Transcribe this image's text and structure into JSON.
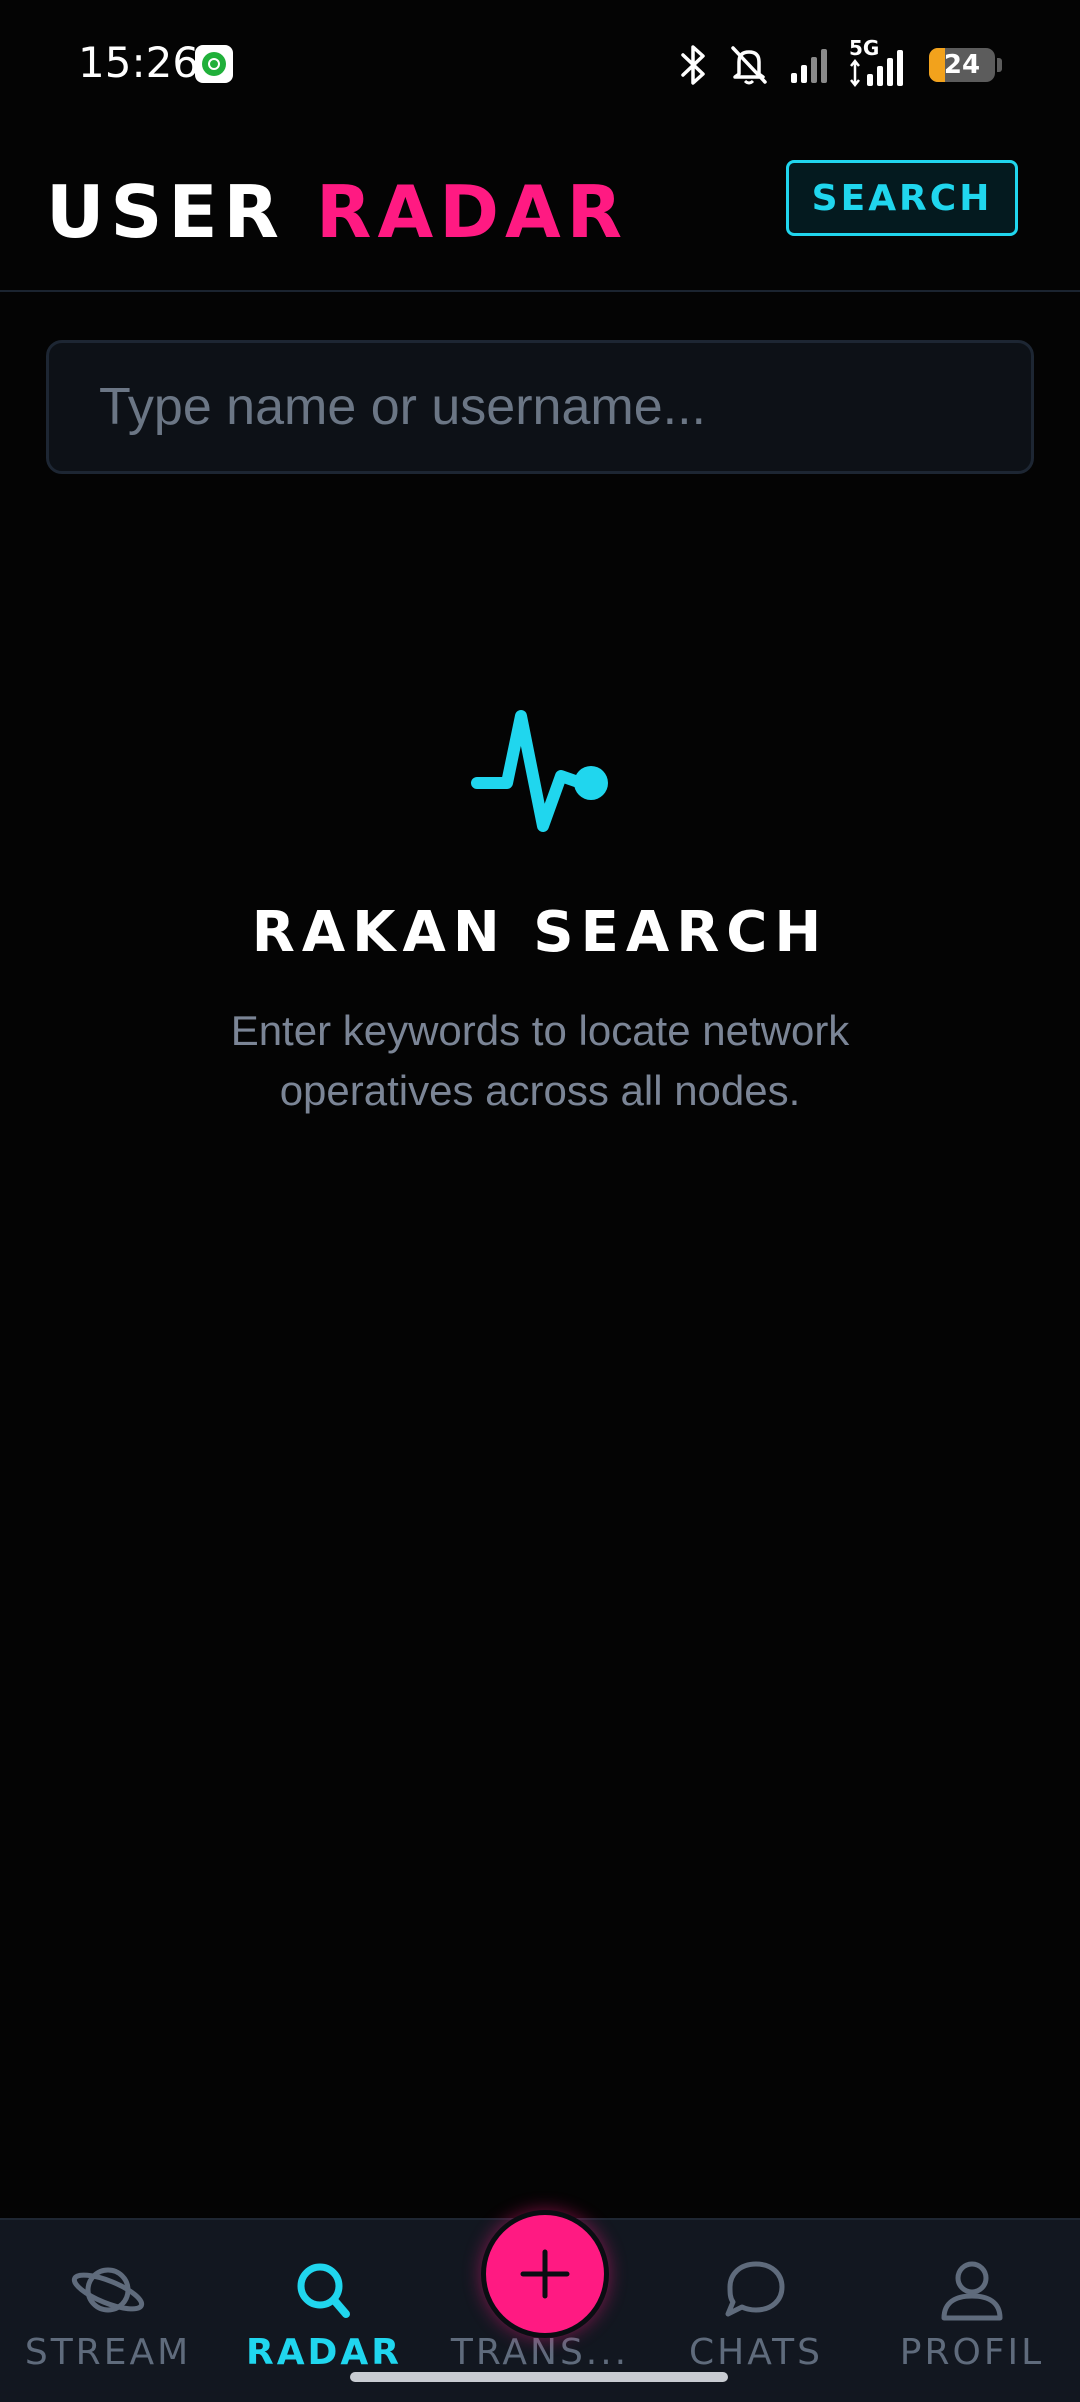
{
  "status_bar": {
    "time": "15:26",
    "network": "5G",
    "battery_level": "24",
    "battery_fraction": 0.24
  },
  "header": {
    "title_part1": "USER",
    "title_part2": "RADAR",
    "search_label": "SEARCH"
  },
  "search": {
    "placeholder": "Type name or username...",
    "value": ""
  },
  "empty_state": {
    "icon": "pulse-icon",
    "title": "RAKAN SEARCH",
    "description": "Enter keywords to locate network operatives across all nodes."
  },
  "bottom_nav": {
    "items": [
      {
        "label": "STREAM",
        "icon": "planet-icon",
        "active": false
      },
      {
        "label": "RADAR",
        "icon": "search-icon",
        "active": true
      },
      {
        "label": "TRANS...",
        "icon": "plus-icon",
        "active": false
      },
      {
        "label": "CHATS",
        "icon": "chat-bubble-icon",
        "active": false
      },
      {
        "label": "PROFIL",
        "icon": "user-icon",
        "active": false
      }
    ]
  },
  "colors": {
    "accent_cyan": "#20d6ee",
    "accent_pink": "#ff1a82",
    "background": "#040404",
    "muted_text": "#7b8596"
  }
}
